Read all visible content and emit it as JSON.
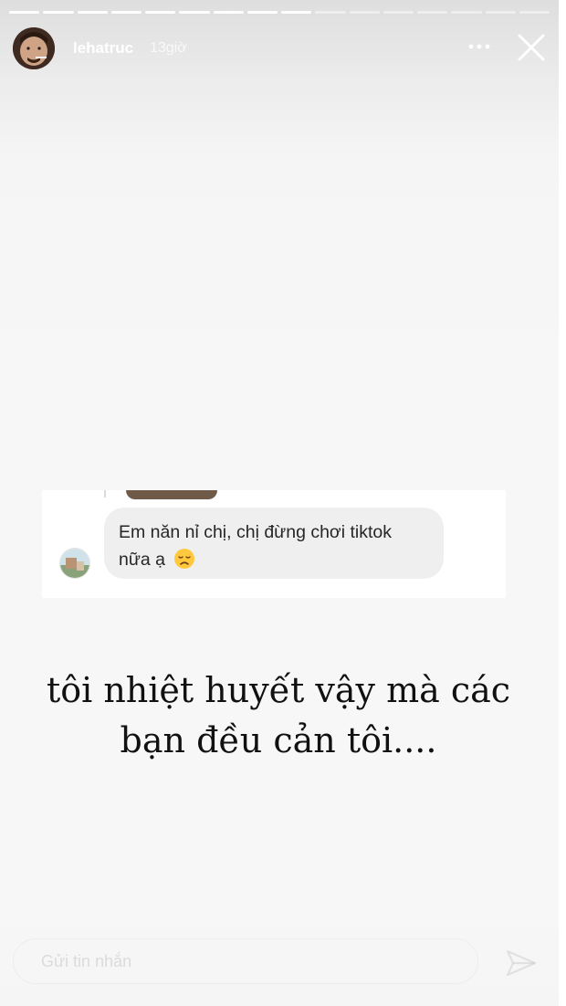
{
  "story": {
    "progress_total": 16,
    "progress_done": 9
  },
  "header": {
    "username": "lehatruc",
    "time": "13giờ",
    "more_icon": "more-horizontal-icon",
    "close_icon": "close-icon"
  },
  "chat": {
    "message_line1": "Em năn nỉ chị, chị đừng chơi tiktok",
    "message_line2": "nữa ạ",
    "emoji_icon": "disappointed-face-emoji"
  },
  "caption": {
    "line1": "tôi nhiệt huyết vậy mà các",
    "line2": "bạn đều cản tôi...."
  },
  "reply": {
    "placeholder": "Gửi tin nhắn",
    "send_icon": "send-icon"
  },
  "colors": {
    "story_background": "#f7f7f7",
    "bubble_background": "#efefef",
    "caption_text": "#111111"
  }
}
